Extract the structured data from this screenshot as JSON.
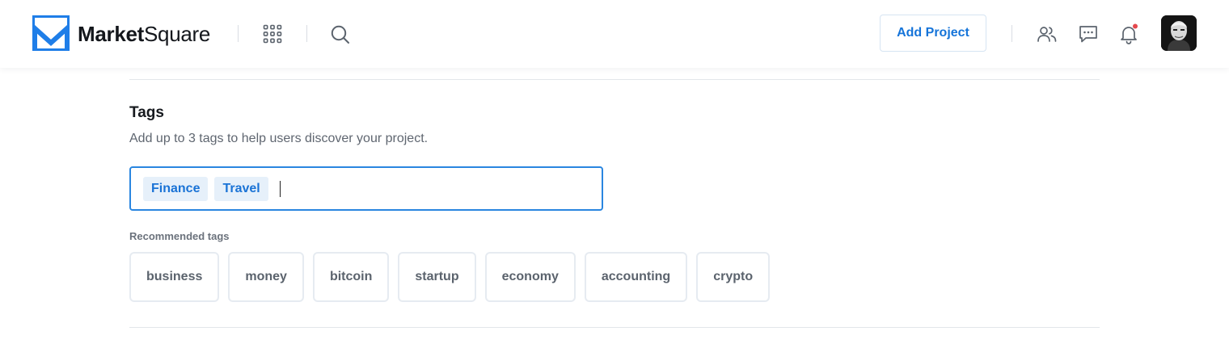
{
  "header": {
    "brand_bold": "Market",
    "brand_regular": "Square",
    "add_project_label": "Add Project",
    "icons": [
      "logo-icon",
      "apps-grid-icon",
      "search-icon",
      "users-icon",
      "chat-icon",
      "bell-icon"
    ],
    "has_notification": true,
    "notification_color": "#e5484d",
    "accent_color": "#1574d9"
  },
  "tags_section": {
    "title": "Tags",
    "description": "Add up to 3 tags to help users discover your project.",
    "selected_tags": [
      "Finance",
      "Travel"
    ],
    "input_value": "",
    "recommended_label": "Recommended tags",
    "recommended": [
      "business",
      "money",
      "bitcoin",
      "startup",
      "economy",
      "accounting",
      "crypto"
    ]
  }
}
